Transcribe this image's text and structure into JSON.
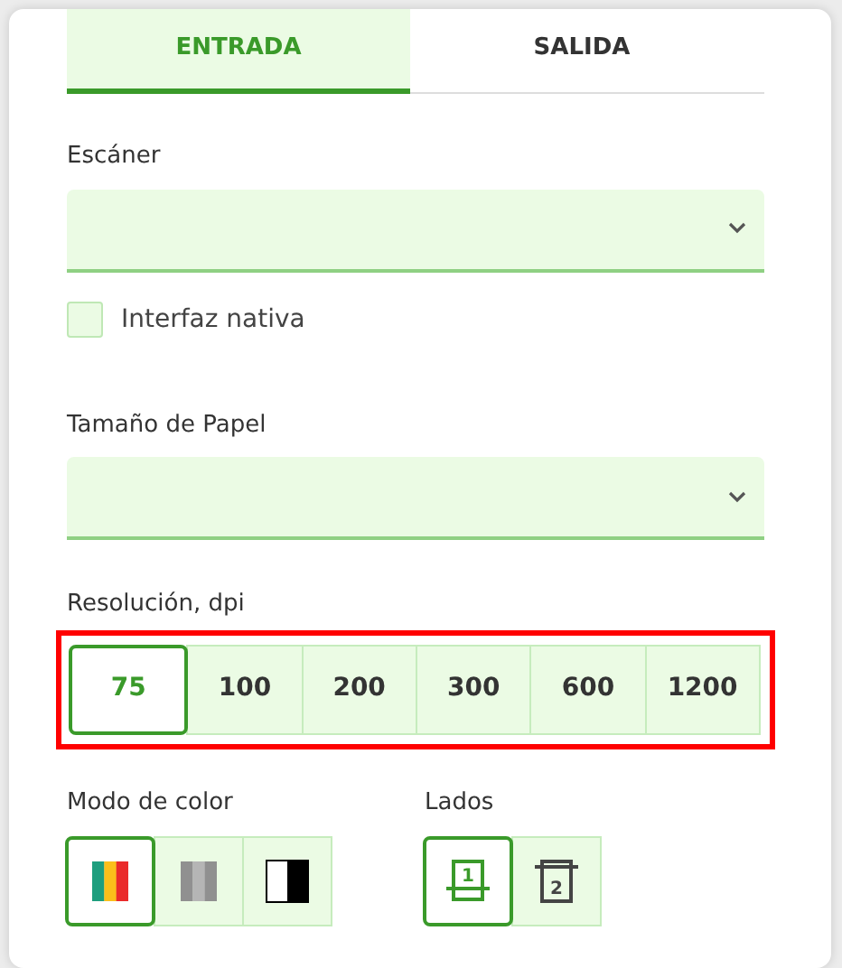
{
  "tabs": [
    {
      "label": "ENTRADA",
      "selected": true
    },
    {
      "label": "SALIDA",
      "selected": false
    }
  ],
  "scanner": {
    "label": "Escáner"
  },
  "native_interface": {
    "label": "Interfaz nativa",
    "checked": false
  },
  "paper_size": {
    "label": "Tamaño de Papel"
  },
  "resolution": {
    "label": "Resolución, dpi",
    "highlighted": true,
    "options": [
      {
        "label": "75",
        "selected": true
      },
      {
        "label": "100",
        "selected": false
      },
      {
        "label": "200",
        "selected": false
      },
      {
        "label": "300",
        "selected": false
      },
      {
        "label": "600",
        "selected": false
      },
      {
        "label": "1200",
        "selected": false
      }
    ]
  },
  "color_mode": {
    "label": "Modo de color",
    "options": [
      {
        "kind": "color",
        "selected": true
      },
      {
        "kind": "gray",
        "selected": false
      },
      {
        "kind": "bw",
        "selected": false
      }
    ]
  },
  "sides": {
    "label": "Lados",
    "options": [
      {
        "kind": "simplex",
        "label": "1",
        "selected": true
      },
      {
        "kind": "duplex",
        "label": "2",
        "selected": false
      }
    ]
  }
}
